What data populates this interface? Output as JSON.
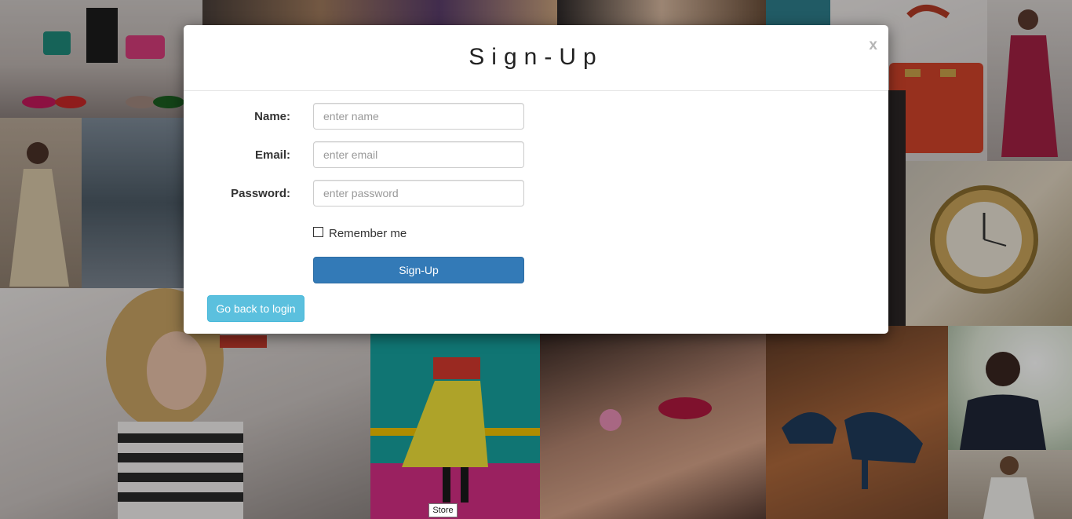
{
  "modal": {
    "title": "Sign-Up",
    "close_label": "x"
  },
  "form": {
    "name_label": "Name:",
    "name_placeholder": "enter name",
    "email_label": "Email:",
    "email_placeholder": "enter email",
    "password_label": "Password:",
    "password_placeholder": "enter password",
    "remember_label": "Remember me",
    "signup_button": "Sign-Up",
    "back_button": "Go back to login"
  },
  "tooltip": "Store",
  "colors": {
    "primary": "#337ab7",
    "info": "#5bc0de"
  }
}
